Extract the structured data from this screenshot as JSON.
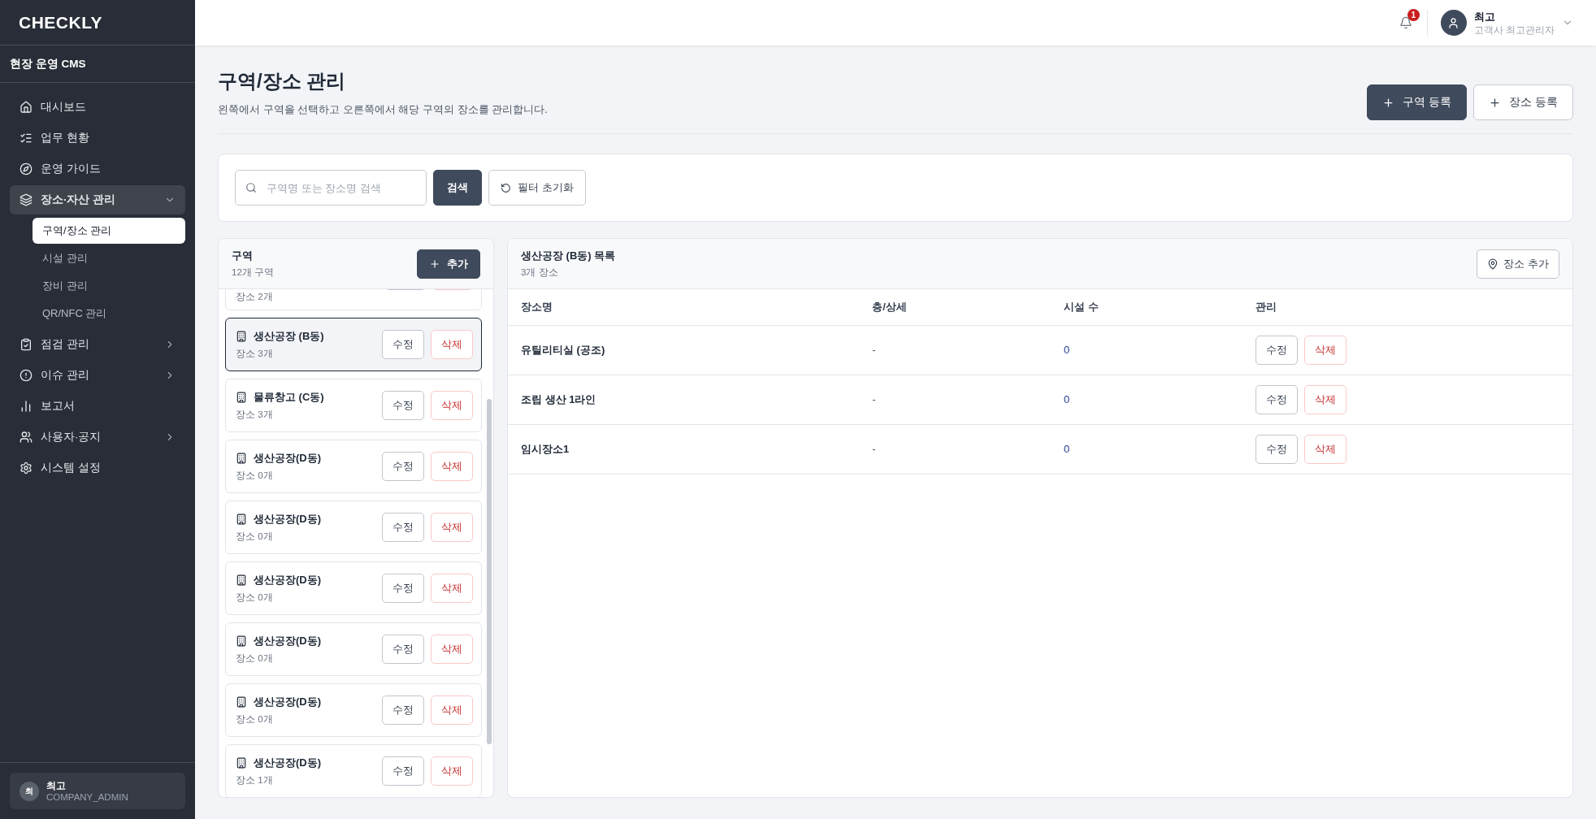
{
  "brand": {
    "logo": "CHECKLY",
    "subtitle": "현장 운영 CMS"
  },
  "sidebar": {
    "items": [
      {
        "label": "대시보드",
        "selected": false
      },
      {
        "label": "업무 현황",
        "selected": false
      },
      {
        "label": "운영 가이드",
        "selected": false
      },
      {
        "label": "장소·자산 관리",
        "selected": false,
        "expanded": true,
        "children": [
          {
            "label": "구역/장소 관리",
            "selected": true
          },
          {
            "label": "시설 관리",
            "selected": false
          },
          {
            "label": "장비 관리",
            "selected": false
          },
          {
            "label": "QR/NFC 관리",
            "selected": false
          }
        ]
      },
      {
        "label": "점검 관리",
        "selected": false,
        "expanded": false
      },
      {
        "label": "이슈 관리",
        "selected": false,
        "expanded": false
      },
      {
        "label": "보고서",
        "selected": false
      },
      {
        "label": "사용자·공지",
        "selected": false,
        "expanded": false
      },
      {
        "label": "시스템 설정",
        "selected": false
      }
    ],
    "user": {
      "initial": "최",
      "name": "최고",
      "role": "COMPANY_ADMIN"
    }
  },
  "header": {
    "notification_count": "1",
    "user_name": "최고",
    "user_role": "고객사 최고관리자"
  },
  "page": {
    "title": "구역/장소 관리",
    "description": "왼쪽에서 구역을 선택하고 오른쪽에서 해당 구역의 장소를 관리합니다.",
    "buttons": [
      {
        "label": "구역 등록",
        "kind": "primary"
      },
      {
        "label": "장소 등록",
        "kind": "secondary"
      }
    ]
  },
  "search": {
    "placeholder": "구역명 또는 장소명 검색",
    "button": "검색",
    "reset": "필터 초기화"
  },
  "zones": {
    "title": "구역",
    "count": "12개 구역",
    "add": "추가",
    "items": [
      {
        "kind": "partial",
        "places": "장소 2개"
      },
      {
        "kind": "zone",
        "name": "생산공장 (B동)",
        "places": "장소 3개",
        "selected": true,
        "edit": "수정",
        "delete": "삭제"
      },
      {
        "kind": "zone",
        "name": "물류창고 (C동)",
        "places": "장소 3개",
        "selected": false,
        "edit": "수정",
        "delete": "삭제"
      },
      {
        "kind": "zone",
        "name": "생산공장(D동)",
        "places": "장소 0개",
        "selected": false,
        "edit": "수정",
        "delete": "삭제"
      },
      {
        "kind": "zone",
        "name": "생산공장(D동)",
        "places": "장소 0개",
        "selected": false,
        "edit": "수정",
        "delete": "삭제"
      },
      {
        "kind": "zone",
        "name": "생산공장(D동)",
        "places": "장소 0개",
        "selected": false,
        "edit": "수정",
        "delete": "삭제"
      },
      {
        "kind": "zone",
        "name": "생산공장(D동)",
        "places": "장소 0개",
        "selected": false,
        "edit": "수정",
        "delete": "삭제"
      },
      {
        "kind": "zone",
        "name": "생산공장(D동)",
        "places": "장소 0개",
        "selected": false,
        "edit": "수정",
        "delete": "삭제"
      },
      {
        "kind": "zone",
        "name": "생산공장(D동)",
        "places": "장소 1개",
        "selected": false,
        "edit": "수정",
        "delete": "삭제"
      }
    ]
  },
  "places": {
    "title": "생산공장 (B동) 목록",
    "count": "3개 장소",
    "add": "장소 추가",
    "columns": [
      "장소명",
      "층/상세",
      "시설 수",
      "관리"
    ],
    "rows": [
      {
        "name": "유틸리티실 (공조)",
        "detail": "-",
        "facilities": "0",
        "edit": "수정",
        "delete": "삭제"
      },
      {
        "name": "조립 생산 1라인",
        "detail": "-",
        "facilities": "0",
        "edit": "수정",
        "delete": "삭제"
      },
      {
        "name": "임시장소1",
        "detail": "-",
        "facilities": "0",
        "edit": "수정",
        "delete": "삭제"
      }
    ]
  }
}
